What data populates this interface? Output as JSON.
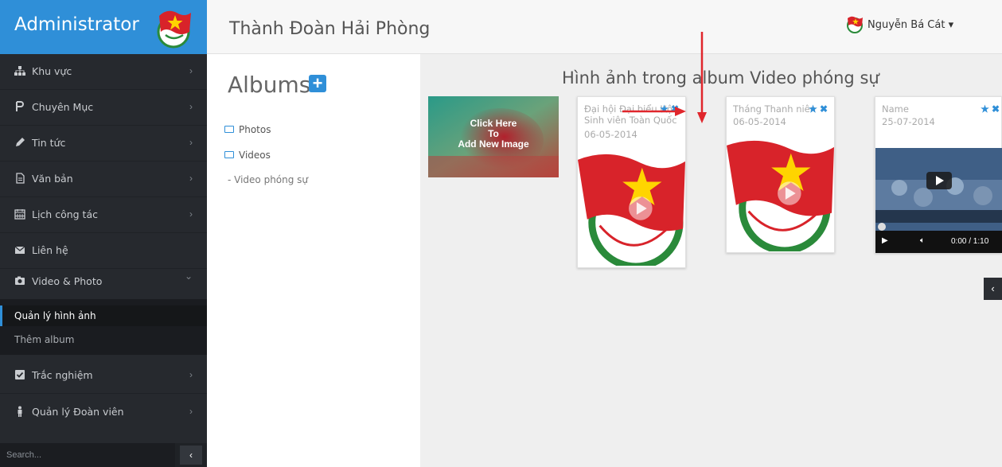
{
  "brand": {
    "title": "Administrator"
  },
  "header": {
    "title": "Thành Đoàn Hải Phòng",
    "user_name": "Nguyễn Bá Cát",
    "user_caret": "▾"
  },
  "sidebar": {
    "items": [
      {
        "label": "Khu vực",
        "icon": "sitemap-icon"
      },
      {
        "label": "Chuyên Mục",
        "icon": "paragraph-icon"
      },
      {
        "label": "Tin tức",
        "icon": "pencil-icon"
      },
      {
        "label": "Văn bản",
        "icon": "document-icon"
      },
      {
        "label": "Lịch công tác",
        "icon": "calendar-icon"
      },
      {
        "label": "Liên hệ",
        "icon": "envelope-icon"
      },
      {
        "label": "Video & Photo",
        "icon": "camera-icon"
      },
      {
        "label": "Trắc nghiệm",
        "icon": "checkbox-icon"
      },
      {
        "label": "Quản lý Đoàn viên",
        "icon": "person-icon"
      }
    ],
    "chevron_right": "›",
    "chevron_down": "⌄",
    "submenu": [
      {
        "label": "Quản lý hình ảnh",
        "active": true
      },
      {
        "label": "Thêm album",
        "active": false
      }
    ],
    "search_placeholder": "Search...",
    "collapse_label": "‹"
  },
  "albums": {
    "title": "Albums",
    "add_label": "+",
    "tree": [
      {
        "label": "Photos"
      },
      {
        "label": "Videos"
      },
      {
        "label": "- Video phóng sự"
      }
    ]
  },
  "images": {
    "title": "Hình ảnh trong album Video phóng sự",
    "add_image_text": "Click Here\nTo\nAdd New Image",
    "cards": [
      {
        "name": "Đại hội Đại biểu Hội Sinh viên Toàn Quốc",
        "date": "06-05-2014",
        "media": "youth-union-logo"
      },
      {
        "name": "Tháng Thanh niên",
        "date": "06-05-2014",
        "media": "youth-union-logo"
      },
      {
        "name": "Name",
        "date": "25-07-2014",
        "media": "video-player",
        "video_time": "0:00 / 1:10"
      }
    ],
    "star_icon": "★",
    "delete_icon": "✖"
  },
  "panel_toggle": "‹",
  "colors": {
    "accent": "#2f8fd8",
    "sidebar_bg": "#26292e",
    "annotation": "#e0262c"
  }
}
